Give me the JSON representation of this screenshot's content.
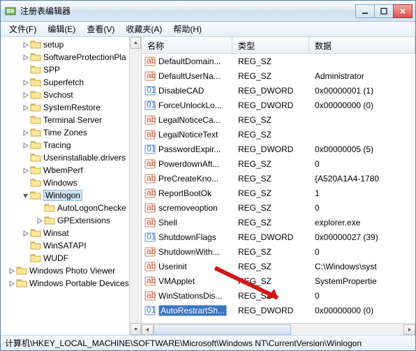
{
  "window": {
    "title": "注册表编辑器"
  },
  "menu": {
    "file": "文件(F)",
    "edit": "编辑(E)",
    "view": "查看(V)",
    "fav": "收藏夹(A)",
    "help": "帮助(H)"
  },
  "tree": {
    "items": [
      {
        "level": 1,
        "exp": "closed",
        "label": "setup"
      },
      {
        "level": 1,
        "exp": "closed",
        "label": "SoftwareProtectionPla"
      },
      {
        "level": 1,
        "exp": "none",
        "label": "SPP"
      },
      {
        "level": 1,
        "exp": "closed",
        "label": "Superfetch"
      },
      {
        "level": 1,
        "exp": "closed",
        "label": "Svchost"
      },
      {
        "level": 1,
        "exp": "closed",
        "label": "SystemRestore"
      },
      {
        "level": 1,
        "exp": "none",
        "label": "Terminal Server"
      },
      {
        "level": 1,
        "exp": "closed",
        "label": "Time Zones"
      },
      {
        "level": 1,
        "exp": "closed",
        "label": "Tracing"
      },
      {
        "level": 1,
        "exp": "none",
        "label": "Userinstallable.drivers"
      },
      {
        "level": 1,
        "exp": "closed",
        "label": "WbemPerf"
      },
      {
        "level": 1,
        "exp": "none",
        "label": "Windows"
      },
      {
        "level": 1,
        "exp": "open",
        "label": "Winlogon",
        "selected": true
      },
      {
        "level": 2,
        "exp": "none",
        "label": "AutoLogonChecke"
      },
      {
        "level": 2,
        "exp": "closed",
        "label": "GPExtensions"
      },
      {
        "level": 1,
        "exp": "closed",
        "label": "Winsat"
      },
      {
        "level": 1,
        "exp": "none",
        "label": "WinSATAPI"
      },
      {
        "level": 1,
        "exp": "none",
        "label": "WUDF"
      },
      {
        "level": 0,
        "exp": "closed",
        "label": "Windows Photo Viewer"
      },
      {
        "level": 0,
        "exp": "closed",
        "label": "Windows Portable Devices"
      }
    ]
  },
  "columns": {
    "name": "名称",
    "type": "类型",
    "data": "数据"
  },
  "values": [
    {
      "icon": "sz",
      "name": "DefaultDomain...",
      "type": "REG_SZ",
      "data": ""
    },
    {
      "icon": "sz",
      "name": "DefaultUserNa...",
      "type": "REG_SZ",
      "data": "Administrator"
    },
    {
      "icon": "dw",
      "name": "DisableCAD",
      "type": "REG_DWORD",
      "data": "0x00000001 (1)"
    },
    {
      "icon": "dw",
      "name": "ForceUnlockLo...",
      "type": "REG_DWORD",
      "data": "0x00000000 (0)"
    },
    {
      "icon": "sz",
      "name": "LegalNoticeCa...",
      "type": "REG_SZ",
      "data": ""
    },
    {
      "icon": "sz",
      "name": "LegalNoticeText",
      "type": "REG_SZ",
      "data": ""
    },
    {
      "icon": "dw",
      "name": "PasswordExpir...",
      "type": "REG_DWORD",
      "data": "0x00000005 (5)"
    },
    {
      "icon": "sz",
      "name": "PowerdownAft...",
      "type": "REG_SZ",
      "data": "0"
    },
    {
      "icon": "sz",
      "name": "PreCreateKno...",
      "type": "REG_SZ",
      "data": "{A520A1A4-1780"
    },
    {
      "icon": "sz",
      "name": "ReportBootOk",
      "type": "REG_SZ",
      "data": "1"
    },
    {
      "icon": "sz",
      "name": "scremoveoption",
      "type": "REG_SZ",
      "data": "0"
    },
    {
      "icon": "sz",
      "name": "Shell",
      "type": "REG_SZ",
      "data": "explorer.exe"
    },
    {
      "icon": "dw",
      "name": "ShutdownFlags",
      "type": "REG_DWORD",
      "data": "0x00000027 (39)"
    },
    {
      "icon": "sz",
      "name": "ShutdownWith...",
      "type": "REG_SZ",
      "data": "0"
    },
    {
      "icon": "sz",
      "name": "Userinit",
      "type": "REG_SZ",
      "data": "C:\\Windows\\syst"
    },
    {
      "icon": "sz",
      "name": "VMApplet",
      "type": "REG_SZ",
      "data": "SystemPropertie"
    },
    {
      "icon": "sz",
      "name": "WinStationsDis...",
      "type": "REG_SZ",
      "data": "0"
    },
    {
      "icon": "dw",
      "name": "AutoRestrartSh...",
      "type": "REG_DWORD",
      "data": "0x00000000 (0)",
      "selected": true
    }
  ],
  "status": "计算机\\HKEY_LOCAL_MACHINE\\SOFTWARE\\Microsoft\\Windows NT\\CurrentVersion\\Winlogon"
}
